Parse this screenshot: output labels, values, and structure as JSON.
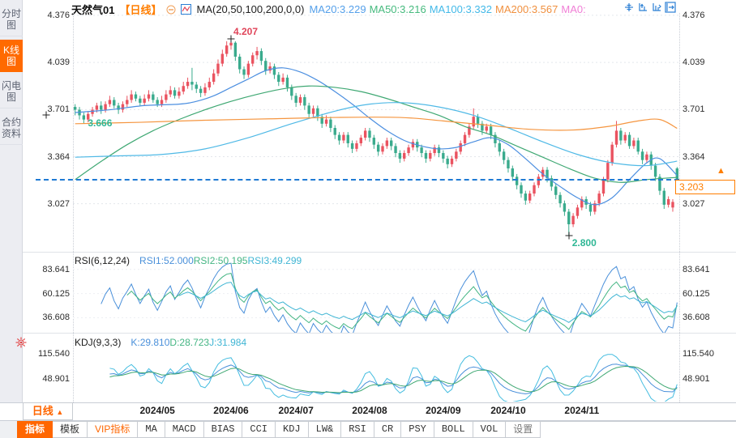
{
  "colors": {
    "up": "#ea5360",
    "down": "#3aab8d",
    "accent": "#ff6600",
    "price_line": "#1f7ad4",
    "grid": "#e3e6ec",
    "ma20_line": "#4c8fe0",
    "ma50_line": "#3fa873",
    "ma100_line": "#4fb9e6",
    "ma200_line": "#f5953f"
  },
  "sidebar": {
    "items": [
      {
        "label": "分时图",
        "active": false
      },
      {
        "label": "K线图",
        "active": true
      },
      {
        "label": "闪电图",
        "active": false
      },
      {
        "label": "合约资料",
        "active": false
      }
    ]
  },
  "header": {
    "symbol": "天然气01",
    "period": "【日线】",
    "ma_formula": "MA(20,50,100,200,0,0)",
    "ma_values": [
      {
        "text": "MA20:3.229",
        "color": "#55a0ea"
      },
      {
        "text": "MA50:3.216",
        "color": "#46ba7e"
      },
      {
        "text": "MA100:3.332",
        "color": "#43b9e8"
      },
      {
        "text": "MA200:3.567",
        "color": "#f0903f"
      },
      {
        "text": "MA0:",
        "color": "#f07fd6"
      }
    ],
    "toolbar_icons": [
      "crosshair-icon",
      "zoom-axis-in-icon",
      "zoom-axis-out-icon",
      "pan-right-icon"
    ]
  },
  "main_axis": {
    "ticks": [
      {
        "label": "4.376",
        "value": 4.376
      },
      {
        "label": "4.039",
        "value": 4.039
      },
      {
        "label": "3.701",
        "value": 3.701
      },
      {
        "label": "3.364",
        "value": 3.364
      },
      {
        "label": "3.027",
        "value": 3.027
      }
    ]
  },
  "rsi": {
    "title": "RSI(6,12,24)",
    "values": [
      {
        "text": "RSI1:52.000",
        "color": "#4a90da"
      },
      {
        "text": "RSI2:50.195",
        "color": "#44b583"
      },
      {
        "text": "RSI3:49.299",
        "color": "#3fb5d4"
      }
    ],
    "ticks": [
      {
        "label": "83.641",
        "value": 83.641
      },
      {
        "label": "60.125",
        "value": 60.125
      },
      {
        "label": "36.608",
        "value": 36.608
      }
    ]
  },
  "kdj": {
    "title": "KDJ(9,3,3)",
    "values": [
      {
        "text": "K:29.810",
        "color": "#4a90da"
      },
      {
        "text": "D:28.723",
        "color": "#44b583"
      },
      {
        "text": "J:31.984",
        "color": "#3fb5d4"
      }
    ],
    "ticks": [
      {
        "label": "115.540",
        "value": 115.54
      },
      {
        "label": "48.901",
        "value": 48.901
      }
    ]
  },
  "xaxis": {
    "period_label": "日线",
    "arrow": "▲",
    "months": [
      {
        "label": "2024/05",
        "index": 19
      },
      {
        "label": "2024/06",
        "index": 36
      },
      {
        "label": "2024/07",
        "index": 51
      },
      {
        "label": "2024/08",
        "index": 68
      },
      {
        "label": "2024/09",
        "index": 85
      },
      {
        "label": "2024/10",
        "index": 100
      },
      {
        "label": "2024/11",
        "index": 117
      }
    ]
  },
  "tabs": [
    {
      "label": "指标",
      "style": "active"
    },
    {
      "label": "模板",
      "style": ""
    },
    {
      "label": "VIP指标",
      "style": "vip"
    },
    {
      "label": "MA",
      "style": "mono"
    },
    {
      "label": "MACD",
      "style": "mono"
    },
    {
      "label": "BIAS",
      "style": "mono"
    },
    {
      "label": "CCI",
      "style": "mono"
    },
    {
      "label": "KDJ",
      "style": "mono"
    },
    {
      "label": "LW&",
      "style": "mono"
    },
    {
      "label": "RSI",
      "style": "mono"
    },
    {
      "label": "CR",
      "style": "mono"
    },
    {
      "label": "PSY",
      "style": "mono"
    },
    {
      "label": "BOLL",
      "style": "mono"
    },
    {
      "label": "VOL",
      "style": "mono"
    },
    {
      "label": "设置",
      "style": "muted"
    }
  ],
  "chart_data": {
    "type": "candlestick",
    "title": "天然气01 日线",
    "price_domain": [
      2.683,
      4.393
    ],
    "rsi_params": [
      6,
      12,
      24
    ],
    "kdj_params": [
      9,
      3,
      3
    ],
    "annotations": {
      "high": {
        "label": "4.207",
        "value": 4.207
      },
      "low": {
        "label": "2.800",
        "value": 2.8
      },
      "ref": {
        "label": "3.666",
        "value": 3.666,
        "index": 2
      },
      "last": {
        "label": "3.203",
        "value": 3.203
      }
    },
    "candles": [
      [
        3.72,
        3.74,
        3.66,
        3.7
      ],
      [
        3.7,
        3.72,
        3.63,
        3.66
      ],
      [
        3.66,
        3.68,
        3.6,
        3.63
      ],
      [
        3.63,
        3.69,
        3.61,
        3.67
      ],
      [
        3.67,
        3.72,
        3.65,
        3.7
      ],
      [
        3.7,
        3.75,
        3.68,
        3.73
      ],
      [
        3.73,
        3.76,
        3.67,
        3.7
      ],
      [
        3.7,
        3.76,
        3.68,
        3.74
      ],
      [
        3.74,
        3.8,
        3.72,
        3.77
      ],
      [
        3.77,
        3.79,
        3.71,
        3.73
      ],
      [
        3.73,
        3.75,
        3.67,
        3.7
      ],
      [
        3.7,
        3.76,
        3.68,
        3.74
      ],
      [
        3.74,
        3.8,
        3.72,
        3.77
      ],
      [
        3.77,
        3.84,
        3.75,
        3.81
      ],
      [
        3.81,
        3.83,
        3.76,
        3.78
      ],
      [
        3.78,
        3.8,
        3.73,
        3.75
      ],
      [
        3.75,
        3.81,
        3.73,
        3.78
      ],
      [
        3.78,
        3.84,
        3.76,
        3.81
      ],
      [
        3.81,
        3.83,
        3.75,
        3.77
      ],
      [
        3.77,
        3.79,
        3.72,
        3.74
      ],
      [
        3.74,
        3.8,
        3.72,
        3.77
      ],
      [
        3.77,
        3.84,
        3.75,
        3.81
      ],
      [
        3.81,
        3.87,
        3.79,
        3.84
      ],
      [
        3.84,
        3.86,
        3.78,
        3.8
      ],
      [
        3.8,
        3.86,
        3.78,
        3.83
      ],
      [
        3.83,
        3.9,
        3.81,
        3.87
      ],
      [
        3.87,
        3.93,
        3.85,
        3.9
      ],
      [
        3.9,
        4.0,
        3.84,
        3.88
      ],
      [
        3.88,
        3.9,
        3.82,
        3.85
      ],
      [
        3.85,
        3.87,
        3.79,
        3.82
      ],
      [
        3.82,
        3.89,
        3.8,
        3.86
      ],
      [
        3.86,
        3.93,
        3.84,
        3.9
      ],
      [
        3.9,
        3.99,
        3.88,
        3.96
      ],
      [
        3.96,
        4.06,
        3.94,
        4.03
      ],
      [
        4.03,
        4.13,
        4.01,
        4.1
      ],
      [
        4.1,
        4.19,
        4.08,
        4.16
      ],
      [
        4.16,
        4.207,
        4.13,
        4.18
      ],
      [
        4.18,
        4.19,
        4.05,
        4.08
      ],
      [
        4.08,
        4.1,
        3.96,
        3.99
      ],
      [
        3.99,
        4.01,
        3.92,
        3.95
      ],
      [
        3.95,
        4.05,
        3.93,
        4.03
      ],
      [
        4.03,
        4.11,
        4.01,
        4.09
      ],
      [
        4.09,
        4.15,
        4.06,
        4.12
      ],
      [
        4.12,
        4.14,
        4.02,
        4.05
      ],
      [
        4.05,
        4.07,
        3.95,
        3.98
      ],
      [
        3.98,
        4.04,
        3.96,
        4.01
      ],
      [
        4.01,
        4.03,
        3.92,
        3.95
      ],
      [
        3.95,
        3.97,
        3.87,
        3.9
      ],
      [
        3.9,
        3.96,
        3.88,
        3.93
      ],
      [
        3.93,
        3.95,
        3.83,
        3.86
      ],
      [
        3.86,
        3.88,
        3.77,
        3.8
      ],
      [
        3.8,
        3.82,
        3.72,
        3.75
      ],
      [
        3.75,
        3.81,
        3.73,
        3.79
      ],
      [
        3.79,
        3.81,
        3.7,
        3.73
      ],
      [
        3.73,
        3.75,
        3.64,
        3.67
      ],
      [
        3.67,
        3.73,
        3.65,
        3.71
      ],
      [
        3.71,
        3.73,
        3.62,
        3.65
      ],
      [
        3.65,
        3.67,
        3.57,
        3.6
      ],
      [
        3.6,
        3.66,
        3.58,
        3.63
      ],
      [
        3.63,
        3.65,
        3.54,
        3.57
      ],
      [
        3.57,
        3.59,
        3.49,
        3.52
      ],
      [
        3.52,
        3.54,
        3.45,
        3.48
      ],
      [
        3.48,
        3.54,
        3.46,
        3.52
      ],
      [
        3.52,
        3.54,
        3.43,
        3.46
      ],
      [
        3.46,
        3.48,
        3.39,
        3.42
      ],
      [
        3.42,
        3.48,
        3.4,
        3.46
      ],
      [
        3.46,
        3.52,
        3.44,
        3.5
      ],
      [
        3.5,
        3.57,
        3.48,
        3.55
      ],
      [
        3.55,
        3.57,
        3.47,
        3.5
      ],
      [
        3.5,
        3.52,
        3.42,
        3.45
      ],
      [
        3.45,
        3.47,
        3.37,
        3.4
      ],
      [
        3.4,
        3.46,
        3.38,
        3.44
      ],
      [
        3.44,
        3.5,
        3.42,
        3.48
      ],
      [
        3.48,
        3.5,
        3.41,
        3.44
      ],
      [
        3.44,
        3.46,
        3.36,
        3.39
      ],
      [
        3.39,
        3.41,
        3.32,
        3.35
      ],
      [
        3.35,
        3.41,
        3.33,
        3.39
      ],
      [
        3.39,
        3.45,
        3.37,
        3.43
      ],
      [
        3.43,
        3.49,
        3.41,
        3.47
      ],
      [
        3.47,
        3.49,
        3.4,
        3.43
      ],
      [
        3.43,
        3.45,
        3.36,
        3.39
      ],
      [
        3.39,
        3.41,
        3.32,
        3.35
      ],
      [
        3.35,
        3.41,
        3.33,
        3.39
      ],
      [
        3.39,
        3.45,
        3.37,
        3.43
      ],
      [
        3.43,
        3.45,
        3.36,
        3.39
      ],
      [
        3.39,
        3.41,
        3.32,
        3.35
      ],
      [
        3.35,
        3.37,
        3.28,
        3.31
      ],
      [
        3.31,
        3.37,
        3.29,
        3.35
      ],
      [
        3.35,
        3.42,
        3.33,
        3.4
      ],
      [
        3.4,
        3.48,
        3.38,
        3.46
      ],
      [
        3.46,
        3.54,
        3.44,
        3.52
      ],
      [
        3.52,
        3.6,
        3.5,
        3.58
      ],
      [
        3.58,
        3.71,
        3.56,
        3.65
      ],
      [
        3.65,
        3.67,
        3.57,
        3.6
      ],
      [
        3.6,
        3.62,
        3.52,
        3.55
      ],
      [
        3.55,
        3.6,
        3.53,
        3.58
      ],
      [
        3.58,
        3.6,
        3.49,
        3.52
      ],
      [
        3.52,
        3.54,
        3.43,
        3.46
      ],
      [
        3.46,
        3.48,
        3.37,
        3.4
      ],
      [
        3.4,
        3.42,
        3.31,
        3.34
      ],
      [
        3.34,
        3.36,
        3.25,
        3.28
      ],
      [
        3.28,
        3.3,
        3.19,
        3.22
      ],
      [
        3.22,
        3.24,
        3.13,
        3.16
      ],
      [
        3.16,
        3.18,
        3.07,
        3.1
      ],
      [
        3.1,
        3.12,
        3.02,
        3.05
      ],
      [
        3.05,
        3.12,
        3.03,
        3.1
      ],
      [
        3.1,
        3.18,
        3.08,
        3.16
      ],
      [
        3.16,
        3.24,
        3.14,
        3.22
      ],
      [
        3.22,
        3.29,
        3.2,
        3.27
      ],
      [
        3.27,
        3.29,
        3.18,
        3.21
      ],
      [
        3.21,
        3.23,
        3.12,
        3.15
      ],
      [
        3.15,
        3.17,
        3.06,
        3.09
      ],
      [
        3.09,
        3.11,
        3.0,
        3.03
      ],
      [
        3.03,
        3.05,
        2.94,
        2.97
      ],
      [
        2.97,
        2.99,
        2.8,
        2.88
      ],
      [
        2.88,
        2.96,
        2.86,
        2.94
      ],
      [
        2.94,
        3.02,
        2.92,
        3.0
      ],
      [
        3.0,
        3.08,
        2.98,
        3.06
      ],
      [
        3.06,
        3.08,
        2.99,
        3.02
      ],
      [
        3.02,
        3.04,
        2.94,
        2.97
      ],
      [
        2.97,
        3.05,
        2.95,
        3.03
      ],
      [
        3.03,
        3.12,
        3.01,
        3.1
      ],
      [
        3.1,
        3.22,
        3.08,
        3.2
      ],
      [
        3.2,
        3.34,
        3.18,
        3.32
      ],
      [
        3.32,
        3.47,
        3.3,
        3.45
      ],
      [
        3.45,
        3.62,
        3.43,
        3.55
      ],
      [
        3.55,
        3.57,
        3.45,
        3.48
      ],
      [
        3.48,
        3.54,
        3.46,
        3.52
      ],
      [
        3.52,
        3.54,
        3.42,
        3.44
      ],
      [
        3.44,
        3.5,
        3.42,
        3.48
      ],
      [
        3.48,
        3.5,
        3.38,
        3.4
      ],
      [
        3.4,
        3.42,
        3.31,
        3.34
      ],
      [
        3.34,
        3.4,
        3.32,
        3.38
      ],
      [
        3.38,
        3.4,
        3.27,
        3.3
      ],
      [
        3.3,
        3.32,
        3.19,
        3.22
      ],
      [
        3.22,
        3.24,
        3.09,
        3.12
      ],
      [
        3.12,
        3.14,
        2.99,
        3.02
      ],
      [
        3.02,
        3.08,
        3.0,
        3.06
      ],
      [
        3.0,
        3.06,
        2.97,
        3.04
      ],
      [
        3.28,
        3.29,
        3.1,
        3.203
      ]
    ],
    "overlays": {
      "ma20": [
        [
          0,
          3.68
        ],
        [
          8,
          3.7
        ],
        [
          16,
          3.73
        ],
        [
          24,
          3.74
        ],
        [
          28,
          3.76
        ],
        [
          32,
          3.8
        ],
        [
          36,
          3.86
        ],
        [
          40,
          3.92
        ],
        [
          44,
          3.98
        ],
        [
          48,
          4.0
        ],
        [
          52,
          3.97
        ],
        [
          56,
          3.91
        ],
        [
          60,
          3.83
        ],
        [
          64,
          3.74
        ],
        [
          68,
          3.64
        ],
        [
          72,
          3.55
        ],
        [
          76,
          3.48
        ],
        [
          80,
          3.44
        ],
        [
          84,
          3.42
        ],
        [
          88,
          3.43
        ],
        [
          92,
          3.47
        ],
        [
          96,
          3.5
        ],
        [
          100,
          3.45
        ],
        [
          104,
          3.35
        ],
        [
          108,
          3.24
        ],
        [
          112,
          3.15
        ],
        [
          116,
          3.07
        ],
        [
          120,
          3.02
        ],
        [
          124,
          3.07
        ],
        [
          128,
          3.2
        ],
        [
          132,
          3.32
        ],
        [
          135,
          3.35
        ],
        [
          139,
          3.229
        ]
      ],
      "ma50": [
        [
          0,
          3.2
        ],
        [
          6,
          3.33
        ],
        [
          12,
          3.45
        ],
        [
          18,
          3.55
        ],
        [
          24,
          3.63
        ],
        [
          30,
          3.7
        ],
        [
          36,
          3.76
        ],
        [
          42,
          3.81
        ],
        [
          48,
          3.85
        ],
        [
          54,
          3.87
        ],
        [
          60,
          3.86
        ],
        [
          66,
          3.83
        ],
        [
          72,
          3.78
        ],
        [
          78,
          3.72
        ],
        [
          84,
          3.66
        ],
        [
          90,
          3.58
        ],
        [
          96,
          3.52
        ],
        [
          102,
          3.44
        ],
        [
          108,
          3.36
        ],
        [
          114,
          3.28
        ],
        [
          120,
          3.21
        ],
        [
          126,
          3.18
        ],
        [
          132,
          3.2
        ],
        [
          139,
          3.216
        ]
      ],
      "ma100": [
        [
          0,
          3.36
        ],
        [
          10,
          3.37
        ],
        [
          20,
          3.38
        ],
        [
          30,
          3.42
        ],
        [
          40,
          3.5
        ],
        [
          50,
          3.6
        ],
        [
          60,
          3.69
        ],
        [
          68,
          3.74
        ],
        [
          76,
          3.75
        ],
        [
          84,
          3.72
        ],
        [
          92,
          3.66
        ],
        [
          100,
          3.57
        ],
        [
          108,
          3.47
        ],
        [
          116,
          3.38
        ],
        [
          124,
          3.32
        ],
        [
          132,
          3.3
        ],
        [
          139,
          3.332
        ]
      ],
      "ma200": [
        [
          0,
          3.6
        ],
        [
          15,
          3.61
        ],
        [
          30,
          3.625
        ],
        [
          45,
          3.635
        ],
        [
          60,
          3.645
        ],
        [
          75,
          3.645
        ],
        [
          85,
          3.62
        ],
        [
          95,
          3.59
        ],
        [
          105,
          3.56
        ],
        [
          115,
          3.555
        ],
        [
          123,
          3.58
        ],
        [
          130,
          3.62
        ],
        [
          135,
          3.63
        ],
        [
          139,
          3.567
        ]
      ]
    }
  }
}
